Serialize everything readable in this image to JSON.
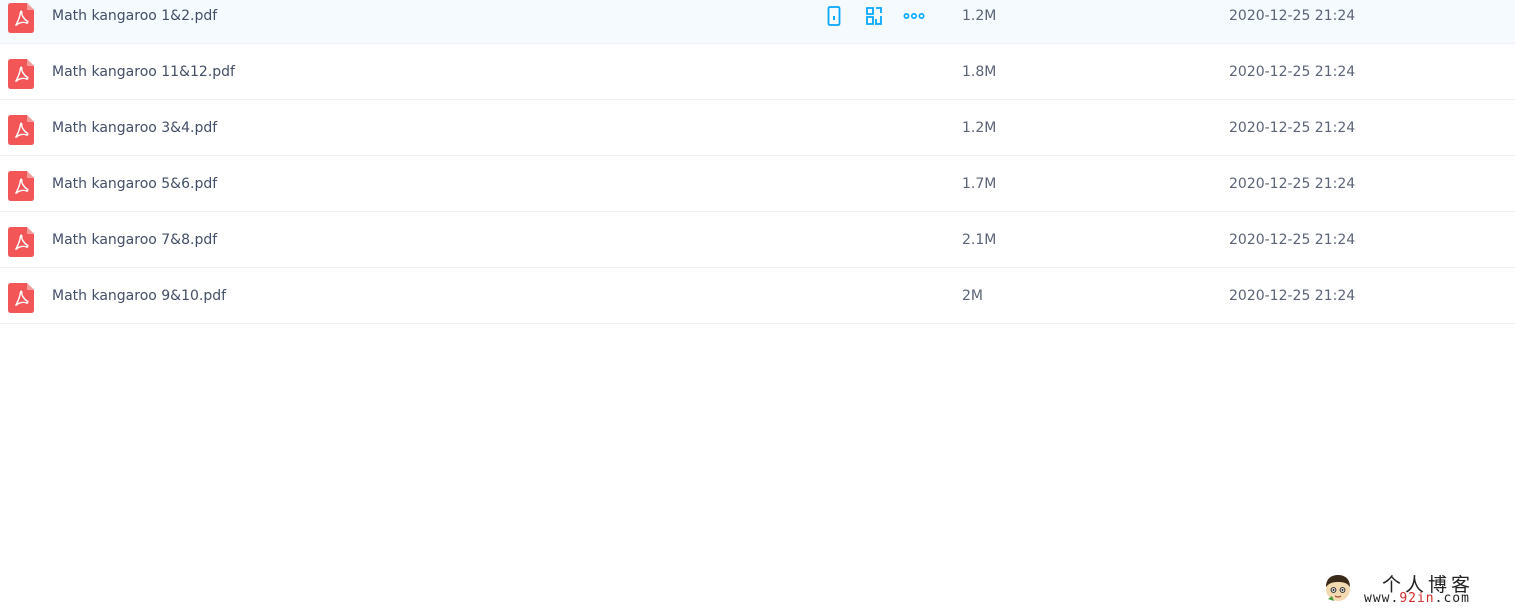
{
  "files": [
    {
      "name": "Math kangaroo 1&2.pdf",
      "size": "1.2M",
      "date": "2020-12-25 21:24",
      "hovered": true
    },
    {
      "name": "Math kangaroo 11&12.pdf",
      "size": "1.8M",
      "date": "2020-12-25 21:24",
      "hovered": false
    },
    {
      "name": "Math kangaroo 3&4.pdf",
      "size": "1.2M",
      "date": "2020-12-25 21:24",
      "hovered": false
    },
    {
      "name": "Math kangaroo 5&6.pdf",
      "size": "1.7M",
      "date": "2020-12-25 21:24",
      "hovered": false
    },
    {
      "name": "Math kangaroo 7&8.pdf",
      "size": "2.1M",
      "date": "2020-12-25 21:24",
      "hovered": false
    },
    {
      "name": "Math kangaroo 9&10.pdf",
      "size": "2M",
      "date": "2020-12-25 21:24",
      "hovered": false
    }
  ],
  "row_actions": {
    "icons": [
      "mobile-icon",
      "share-icon",
      "more-icon"
    ]
  },
  "watermark": {
    "title": "个人博客",
    "url_prefix": "www.",
    "url_accent": "92in",
    "url_suffix": ".com"
  },
  "colors": {
    "accent": "#06a7ff",
    "pdf_red": "#f25656",
    "hover_bg": "#f4fafe"
  }
}
